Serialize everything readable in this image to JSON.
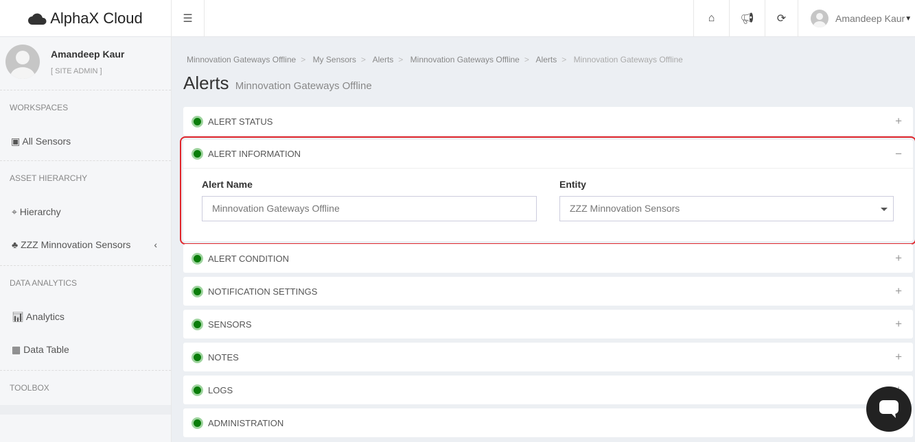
{
  "brand": "AlphaX Cloud",
  "header": {
    "user": "Amandeep Kaur",
    "icons": [
      "home-icon",
      "megaphone-icon",
      "refresh-icon"
    ]
  },
  "sidebar": {
    "name": "Amandeep Kaur",
    "role": "[ SITE ADMIN ]",
    "sections": {
      "workspaces": "WORKSPACES",
      "asset": "ASSET HIERARCHY",
      "analytics": "DATA ANALYTICS",
      "toolbox": "TOOLBOX"
    },
    "items": {
      "all_sensors": "All Sensors",
      "hierarchy": "Hierarchy",
      "zzz": "ZZZ Minnovation Sensors",
      "analytics": "Analytics",
      "data_table": "Data Table"
    }
  },
  "breadcrumb": [
    "Minnovation Gateways Offline",
    "My Sensors",
    "Alerts",
    "Minnovation Gateways Offline",
    "Alerts",
    "Minnovation Gateways Offline"
  ],
  "page": {
    "title": "Alerts",
    "subtitle": "Minnovation Gateways Offline"
  },
  "panels": [
    "ALERT STATUS",
    "ALERT INFORMATION",
    "ALERT CONDITION",
    "NOTIFICATION SETTINGS",
    "SENSORS",
    "NOTES",
    "LOGS",
    "ADMINISTRATION"
  ],
  "form": {
    "alert_name_label": "Alert Name",
    "alert_name_value": "Minnovation Gateways Offline",
    "entity_label": "Entity",
    "entity_value": "ZZZ Minnovation Sensors"
  },
  "colors": {
    "status": "#0a7d0a",
    "highlight": "#e0252b"
  }
}
